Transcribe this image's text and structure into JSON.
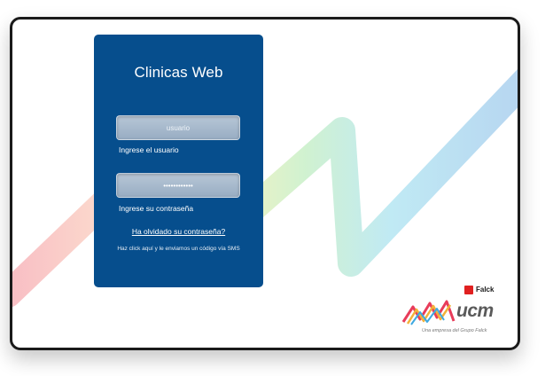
{
  "login": {
    "title": "Clinicas Web",
    "username_placeholder": "usuario",
    "username_hint": "Ingrese el usuario",
    "password_value": "••••••••••••",
    "password_hint": "Ingrese su contraseña",
    "forgot_link": "Ha olvidado su contraseña?",
    "sms_text": "Haz click aquí y le enviamos un código vía SMS"
  },
  "branding": {
    "falck": "Falck",
    "ucm": "ucm",
    "tagline": "Una empresa del Grupo Falck"
  },
  "colors": {
    "panel": "#064e8d",
    "falck_red": "#e02020"
  }
}
